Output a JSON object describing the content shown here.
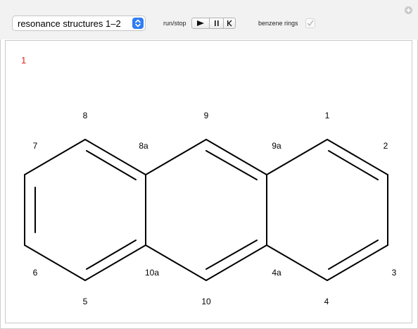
{
  "controls": {
    "structure_select_value": "resonance structures 1–2",
    "run_stop_label": "run/stop",
    "benzene_rings_label": "benzene rings",
    "benzene_rings_checked": true
  },
  "icons": {
    "stepper": "chevron-up-down-icon",
    "play": "play-icon",
    "pause": "pause-icon",
    "reset": "step-back-icon",
    "checkmark": "checkmark-icon",
    "plus": "plus-circle-icon"
  },
  "colors": {
    "structure_number": "#e0261b",
    "stepper_accent": "#2d7cf6"
  },
  "display": {
    "structure_number": "1",
    "atom_labels": {
      "8": "8",
      "9": "9",
      "1": "1",
      "7": "7",
      "8a": "8a",
      "9a": "9a",
      "2": "2",
      "6": "6",
      "10a": "10a",
      "4a": "4a",
      "3": "3",
      "5": "5",
      "10": "10",
      "4": "4"
    }
  }
}
